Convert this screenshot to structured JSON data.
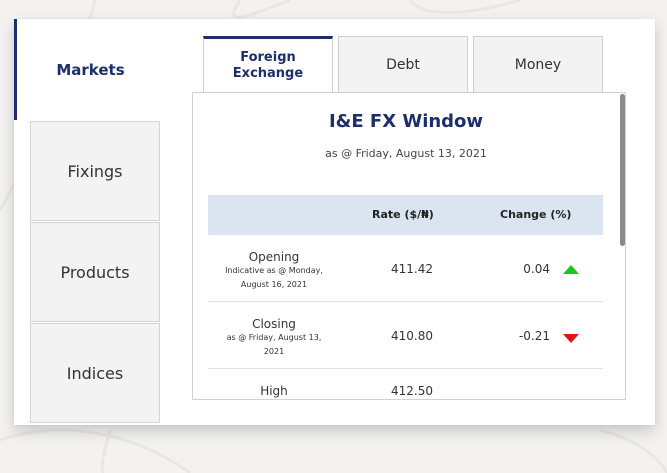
{
  "sidebar": {
    "active": "Markets",
    "items": [
      {
        "label": "Fixings"
      },
      {
        "label": "Products"
      },
      {
        "label": "Indices"
      }
    ]
  },
  "tabs": {
    "fx_line1": "Foreign",
    "fx_line2": "Exchange",
    "debt": "Debt",
    "money": "Money"
  },
  "card": {
    "title": "I&E FX Window",
    "subtitle": "as @ Friday, August 13, 2021",
    "headers": {
      "rate": "Rate ($/₦)",
      "change": "Change (%)"
    },
    "rows": [
      {
        "name": "Opening",
        "note_line1": "Indicative as @ Monday,",
        "note_line2": "August 16, 2021",
        "rate": "411.42",
        "change": "0.04",
        "direction": "up"
      },
      {
        "name": "Closing",
        "note_line1": "as @ Friday, August 13,",
        "note_line2": "2021",
        "rate": "410.80",
        "change": "-0.21",
        "direction": "down"
      },
      {
        "name": "High",
        "note_line1": "",
        "note_line2": "",
        "rate": "412.50",
        "change": "",
        "direction": ""
      }
    ]
  },
  "colors": {
    "brand": "#1b2f6e",
    "header_bg": "#dbe5f1",
    "up": "#18c918",
    "down": "#e01414"
  },
  "icons": {
    "up": "triangle-up-icon",
    "down": "triangle-down-icon"
  }
}
